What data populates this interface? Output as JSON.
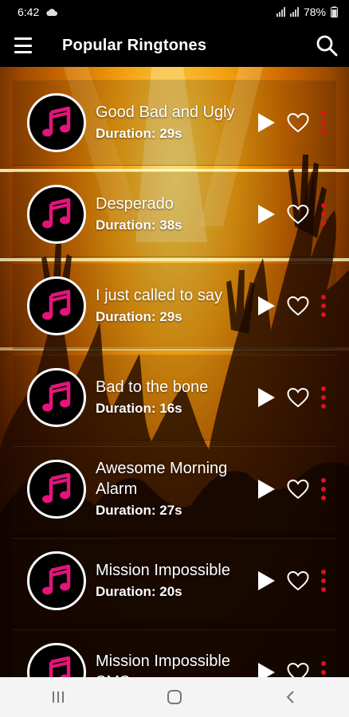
{
  "status_bar": {
    "time": "6:42",
    "battery": "78%",
    "icons": [
      "cloud-icon",
      "volte-signal-icon",
      "volte-signal-icon",
      "battery-icon"
    ]
  },
  "app_bar": {
    "title": "Popular Ringtones",
    "menu_icon": "hamburger-menu-icon",
    "search_icon": "search-icon"
  },
  "ringtones": [
    {
      "title": "Good Bad and Ugly",
      "duration": "Duration: 29s"
    },
    {
      "title": "Desperado",
      "duration": "Duration: 38s"
    },
    {
      "title": "I just called to say",
      "duration": "Duration: 29s"
    },
    {
      "title": "Bad to the bone",
      "duration": "Duration: 16s"
    },
    {
      "title": "Awesome Morning Alarm",
      "duration": "Duration: 27s"
    },
    {
      "title": "Mission Impossible",
      "duration": "Duration: 20s"
    },
    {
      "title": "Mission Impossible SMS",
      "duration": ""
    }
  ],
  "colors": {
    "accent_pink": "#e3147a",
    "more_dots_red": "#e0101f",
    "app_bar_bg": "#000000",
    "nav_bar_bg": "#f4f4f4"
  },
  "nav_bar": {
    "buttons": [
      "recent-apps-icon",
      "home-icon",
      "back-icon"
    ]
  }
}
